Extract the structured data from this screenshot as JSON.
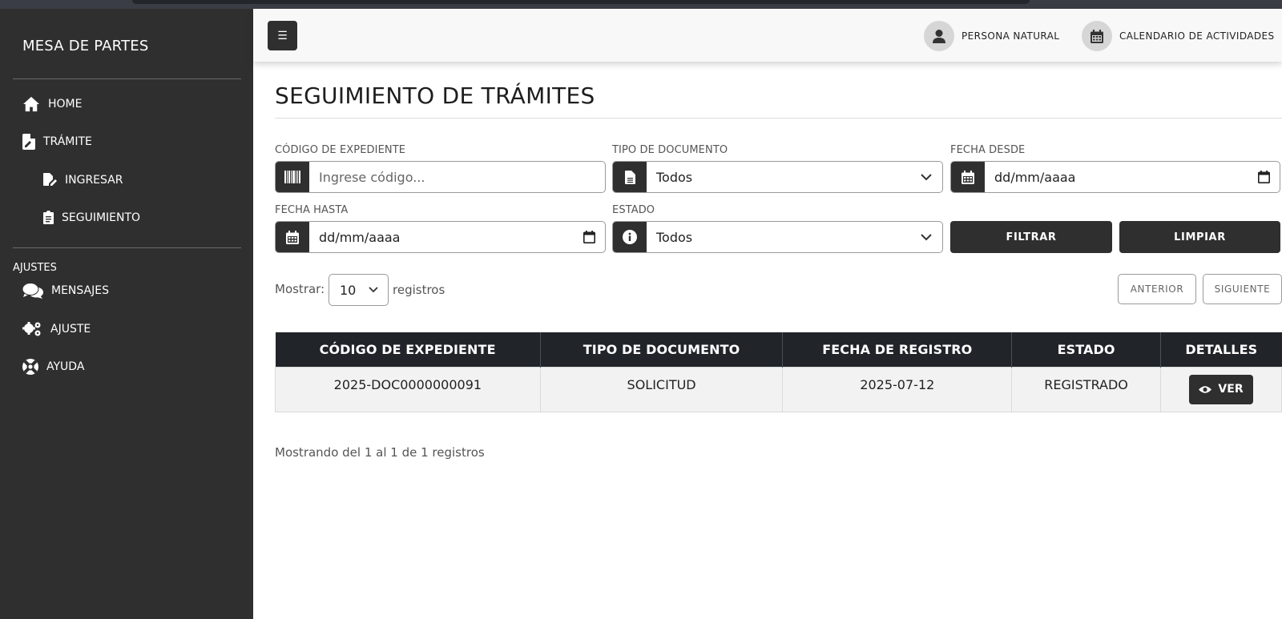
{
  "sidebar": {
    "brand": "MESA DE PARTES",
    "items": [
      {
        "label": "HOME",
        "icon": "home-icon"
      },
      {
        "label": "TRÁMITE",
        "icon": "file-signature-icon"
      },
      {
        "label": "INGRESAR",
        "icon": "file-edit-icon"
      },
      {
        "label": "SEGUIMIENTO",
        "icon": "clipboard-icon"
      }
    ],
    "section": "AJUSTES",
    "settings_items": [
      {
        "label": "MENSAJES",
        "icon": "comments-icon"
      },
      {
        "label": "AJUSTE",
        "icon": "cogs-icon"
      },
      {
        "label": "AYUDA",
        "icon": "life-ring-icon"
      }
    ]
  },
  "topbar": {
    "menu_symbol": "☰",
    "user_link": "PERSONA NATURAL",
    "calendar_link": "CALENDARIO DE ACTIVIDADES"
  },
  "page": {
    "title": "SEGUIMIENTO DE TRÁMITES"
  },
  "filters": {
    "codigo": {
      "label": "CÓDIGO DE EXPEDIENTE",
      "placeholder": "Ingrese código...",
      "icon": "barcode-icon"
    },
    "tipo": {
      "label": "TIPO DE DOCUMENTO",
      "value": "Todos",
      "icon": "file-alt-icon"
    },
    "desde": {
      "label": "FECHA DESDE",
      "value": "dd/mm/aaaa",
      "icon": "calendar-icon"
    },
    "hasta": {
      "label": "FECHA HASTA",
      "value": "dd/mm/aaaa",
      "icon": "calendar-icon"
    },
    "estado": {
      "label": "ESTADO",
      "value": "Todos",
      "icon": "info-circle-icon"
    },
    "filter_button": "FILTRAR",
    "clear_button": "LIMPIAR"
  },
  "pagination": {
    "show_label": "Mostrar:",
    "page_size": "10",
    "records_label": "registros",
    "prev": "ANTERIOR",
    "next": "SIGUIENTE"
  },
  "table": {
    "headers": [
      "CÓDIGO DE EXPEDIENTE",
      "TIPO DE DOCUMENTO",
      "FECHA DE REGISTRO",
      "ESTADO",
      "DETALLES"
    ],
    "rows": [
      {
        "codigo": "2025-DOC0000000091",
        "tipo": "SOLICITUD",
        "fecha": "2025-07-12",
        "estado": "REGISTRADO",
        "action": "VER"
      }
    ]
  },
  "footer": {
    "info": "Mostrando del 1 al 1 de 1 registros"
  },
  "colors": {
    "sidebar_bg": "#2f2f2f",
    "table_header_bg": "#212529",
    "button_dark": "#2f2f2f"
  }
}
